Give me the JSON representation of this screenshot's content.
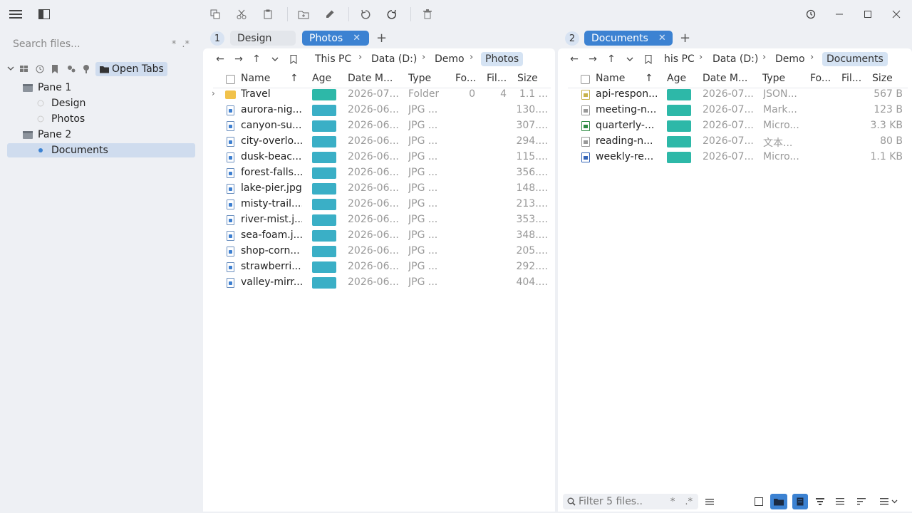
{
  "window": {
    "history_icon": "history-icon",
    "minimize": "minimize-icon",
    "maximize": "maximize-icon",
    "close": "close-icon"
  },
  "toolbar": {
    "icons": [
      "copy-icon",
      "cut-icon",
      "paste-icon",
      "new-folder-icon",
      "rename-icon",
      "undo-icon",
      "redo-icon",
      "delete-icon"
    ]
  },
  "sidebar": {
    "search_placeholder": "Search files...",
    "search_wild": "*",
    "search_regex": ".*",
    "open_tabs_label": "Open Tabs",
    "panes": [
      {
        "label": "Pane 1",
        "tabs": [
          "Design",
          "Photos"
        ]
      },
      {
        "label": "Pane 2",
        "tabs": [
          "Documents"
        ]
      }
    ],
    "selected": "Documents"
  },
  "pane1": {
    "number": "1",
    "tabs": [
      {
        "label": "Design",
        "active": false
      },
      {
        "label": "Photos",
        "active": true
      }
    ],
    "breadcrumb": [
      "This PC",
      "Data (D:)",
      "Demo",
      "Photos"
    ],
    "columns": [
      "Name",
      "Age",
      "Date M...",
      "Type",
      "Fo...",
      "Fil...",
      "Size"
    ],
    "rows": [
      {
        "name": "Travel",
        "date": "2026-07...",
        "type": "Folder",
        "folders": "0",
        "files": "4",
        "size": "1.1 ...",
        "kind": "folder",
        "age_color": "#2db8a8"
      },
      {
        "name": "aurora-nig...",
        "date": "2026-06...",
        "type": "JPG ...",
        "size": "130....",
        "kind": "jpg",
        "age_color": "#3aafc6"
      },
      {
        "name": "canyon-su...",
        "date": "2026-06...",
        "type": "JPG ...",
        "size": "307....",
        "kind": "jpg",
        "age_color": "#3aafc6"
      },
      {
        "name": "city-overlo...",
        "date": "2026-06...",
        "type": "JPG ...",
        "size": "294....",
        "kind": "jpg",
        "age_color": "#3aafc6"
      },
      {
        "name": "dusk-beac...",
        "date": "2026-06...",
        "type": "JPG ...",
        "size": "115....",
        "kind": "jpg",
        "age_color": "#3aafc6"
      },
      {
        "name": "forest-falls...",
        "date": "2026-06...",
        "type": "JPG ...",
        "size": "356....",
        "kind": "jpg",
        "age_color": "#3aafc6"
      },
      {
        "name": "lake-pier.jpg",
        "date": "2026-06...",
        "type": "JPG ...",
        "size": "148....",
        "kind": "jpg",
        "age_color": "#3aafc6"
      },
      {
        "name": "misty-trail....",
        "date": "2026-06...",
        "type": "JPG ...",
        "size": "213....",
        "kind": "jpg",
        "age_color": "#3aafc6"
      },
      {
        "name": "river-mist.j...",
        "date": "2026-06...",
        "type": "JPG ...",
        "size": "353....",
        "kind": "jpg",
        "age_color": "#3aafc6"
      },
      {
        "name": "sea-foam.j...",
        "date": "2026-06...",
        "type": "JPG ...",
        "size": "348....",
        "kind": "jpg",
        "age_color": "#3aafc6"
      },
      {
        "name": "shop-corn...",
        "date": "2026-06...",
        "type": "JPG ...",
        "size": "205....",
        "kind": "jpg",
        "age_color": "#3aafc6"
      },
      {
        "name": "strawberri...",
        "date": "2026-06...",
        "type": "JPG ...",
        "size": "292....",
        "kind": "jpg",
        "age_color": "#3aafc6"
      },
      {
        "name": "valley-mirr...",
        "date": "2026-06...",
        "type": "JPG ...",
        "size": "404....",
        "kind": "jpg",
        "age_color": "#3aafc6"
      }
    ]
  },
  "pane2": {
    "number": "2",
    "tabs": [
      {
        "label": "Documents",
        "active": true
      }
    ],
    "breadcrumb": [
      "his PC",
      "Data (D:)",
      "Demo",
      "Documents"
    ],
    "columns": [
      "Name",
      "Age",
      "Date M...",
      "Type",
      "Fo...",
      "Fil...",
      "Size"
    ],
    "rows": [
      {
        "name": "api-respon...",
        "date": "2026-07...",
        "type": "JSON...",
        "size": "567 B",
        "kind": "json",
        "age_color": "#2db8a8"
      },
      {
        "name": "meeting-n...",
        "date": "2026-07...",
        "type": "Mark...",
        "size": "123 B",
        "kind": "md",
        "age_color": "#2db8a8"
      },
      {
        "name": "quarterly-...",
        "date": "2026-07...",
        "type": "Micro...",
        "size": "3.3 KB",
        "kind": "xlsx",
        "age_color": "#2db8a8"
      },
      {
        "name": "reading-n...",
        "date": "2026-07...",
        "type": "文本...",
        "size": "80 B",
        "kind": "txt",
        "age_color": "#2db8a8"
      },
      {
        "name": "weekly-re...",
        "date": "2026-07...",
        "type": "Micro...",
        "size": "1.1 KB",
        "kind": "docx",
        "age_color": "#2db8a8"
      }
    ],
    "filter_placeholder": "Filter 5 files..",
    "filter_wild": "*",
    "filter_regex": ".*"
  }
}
